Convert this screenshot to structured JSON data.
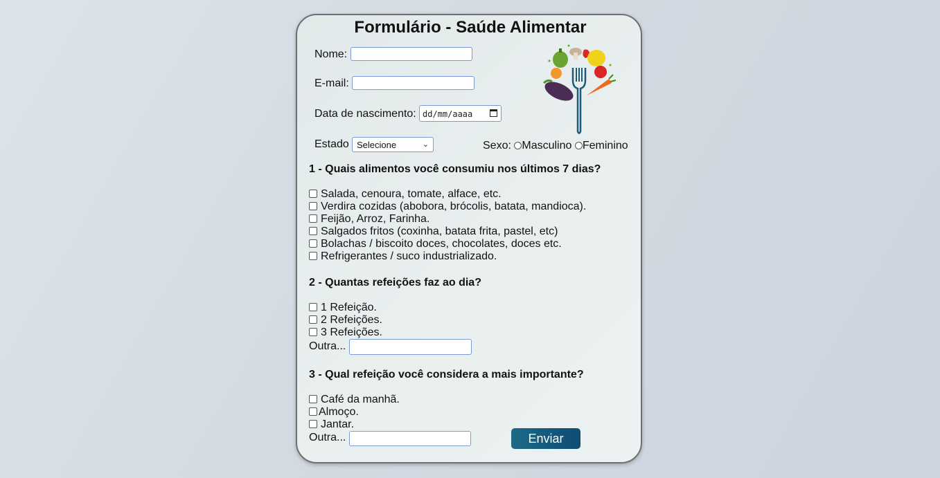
{
  "form": {
    "title": "Formulário - Saúde Alimentar",
    "name_label": "Nome:",
    "email_label": "E-mail:",
    "birth_label": "Data de nascimento:",
    "birth_placeholder": "dd/mm/aaaa",
    "state_label": "Estado",
    "state_selected": "Selecione",
    "sex_label": "Sexo:",
    "sex_options": [
      "Masculino",
      "Feminino"
    ],
    "q1": {
      "title": "1 - Quais alimentos você consumiu nos últimos 7 dias?",
      "options": [
        "Salada, cenoura, tomate, alface, etc.",
        "Verdira cozidas (abobora, brócolis, batata, mandioca).",
        "Feijão, Arroz, Farinha.",
        "Salgados fritos (coxinha, batata frita, pastel, etc)",
        "Bolachas / biscoito doces, chocolates, doces etc.",
        "Refrigerantes / suco industrializado."
      ]
    },
    "q2": {
      "title": "2 - Quantas refeições faz ao dia?",
      "options": [
        "1 Refeição.",
        "2 Refeições.",
        "3 Refeições."
      ],
      "other_label": "Outra..."
    },
    "q3": {
      "title": "3 - Qual refeição você considera a mais importante?",
      "options": [
        "Café da manhã.",
        "Almoço.",
        "Jantar."
      ],
      "other_label": "Outra..."
    },
    "submit_label": "Enviar",
    "logo_icon": "vegetables-fork-logo"
  }
}
